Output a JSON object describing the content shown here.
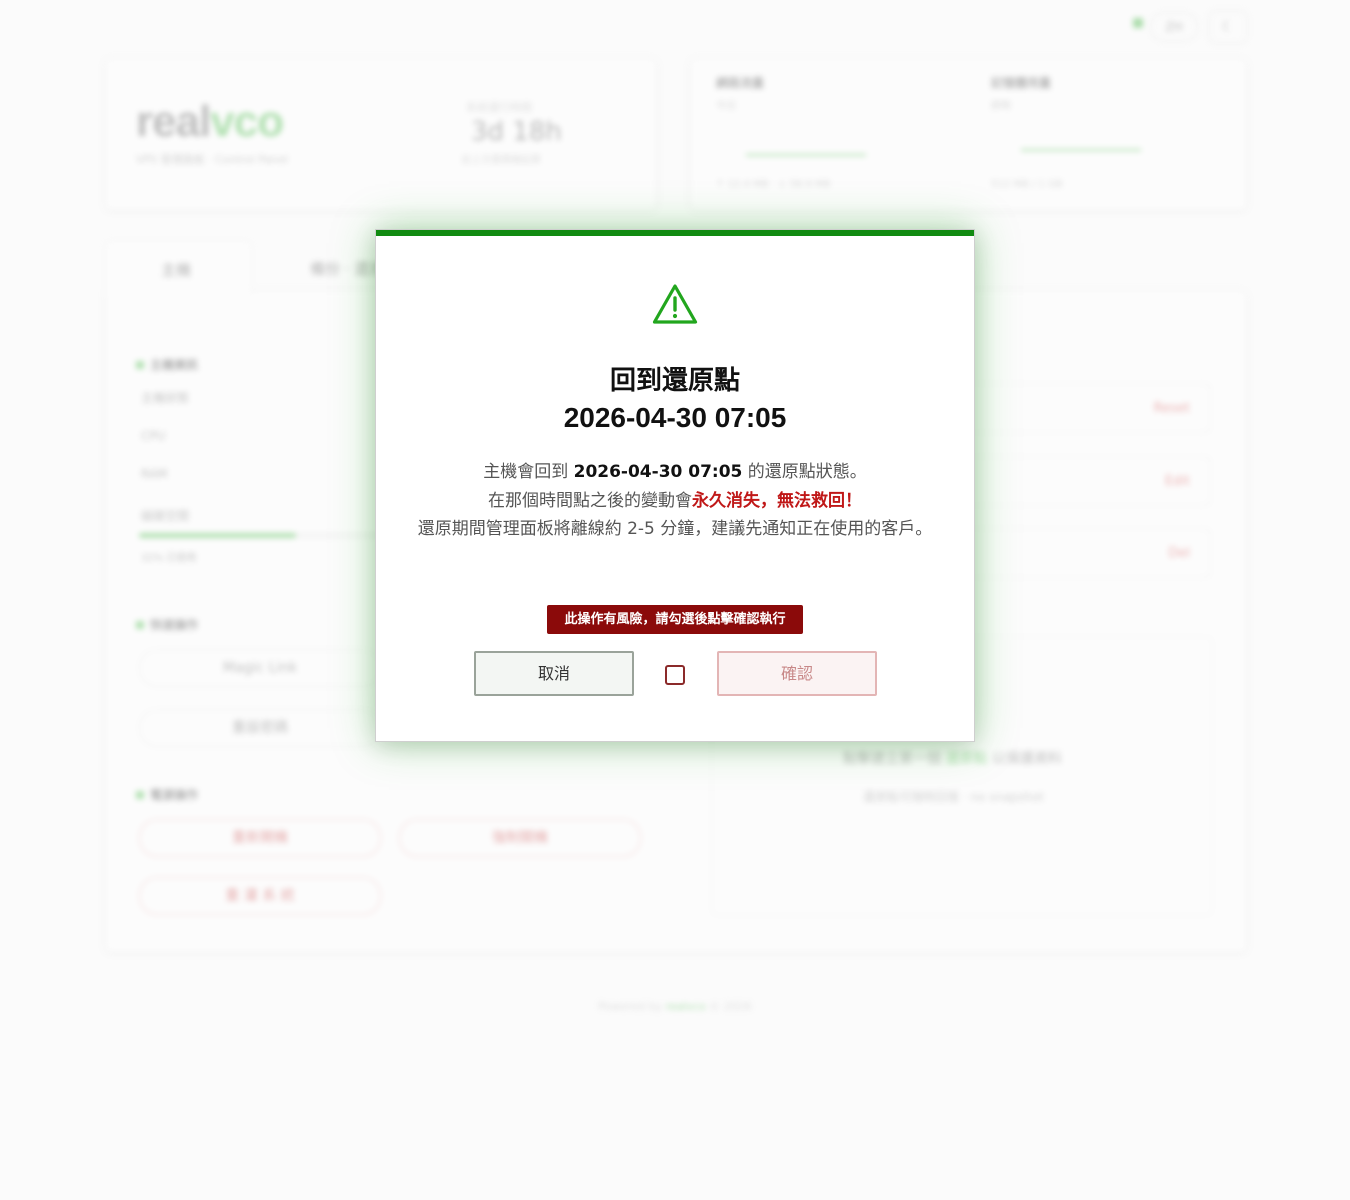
{
  "background": {
    "header": {
      "lang_label": "ZH",
      "theme_icon": "moon-icon"
    },
    "brand": {
      "logo_a": "real",
      "logo_b": "vco",
      "tagline": "VPS 管理面板 · Control Panel"
    },
    "uptime": {
      "label": "系統運行時間",
      "value": "3d 18h",
      "sub": "自上次重開機起算"
    },
    "stats": [
      {
        "title": "網路流量",
        "sub": "今日",
        "foot": "↑ 12.4 MB · ↓ 58.9 MB"
      },
      {
        "title": "記憶體用量",
        "sub": "即時",
        "foot": "512 MB / 1 GB"
      }
    ],
    "tabs": [
      "主機",
      "備份 · 還原"
    ],
    "host_section_title": "主機資訊",
    "host_fields": [
      "主機狀態",
      "CPU",
      "RAM",
      "磁碟空間"
    ],
    "host_disk_note": "32% 已使用",
    "actions_title": "快速操作",
    "actions": [
      "Magic Link",
      "重設密碼"
    ],
    "power_title": "電源操作",
    "power_actions": [
      "重新開機",
      "強制關機",
      "重 灌 系 統"
    ],
    "right_rows": [
      "Reset",
      "Edit",
      "Del"
    ],
    "empty_title_a": "點擊建立第一個",
    "empty_title_b": "還原點",
    "empty_title_c": "以保護資料",
    "empty_sub": "還原點可隨時回復 · no snapshot",
    "footer_a": "Powered by",
    "footer_b": "realvco",
    "footer_c": "© 2026"
  },
  "modal": {
    "icon": "warning-triangle-icon",
    "title": "回到還原點",
    "date": "2026-04-30 07:05",
    "line1_pre": "主機會回到 ",
    "line1_date": "2026-04-30 07:05",
    "line1_post": " 的還原點狀態。",
    "line2_pre": "在那個時間點之後的變動會",
    "line2_danger": "永久消失，無法救回！",
    "line3": "還原期間管理面板將離線約 2-5 分鐘，建議先通知正在使用的客戶。",
    "risk_notice": "此操作有風險，請勾選後點擊確認執行",
    "cancel_label": "取消",
    "confirm_label": "確認",
    "confirm_checked": false,
    "accent_color": "#118b11",
    "danger_color": "#8b0a0a"
  }
}
